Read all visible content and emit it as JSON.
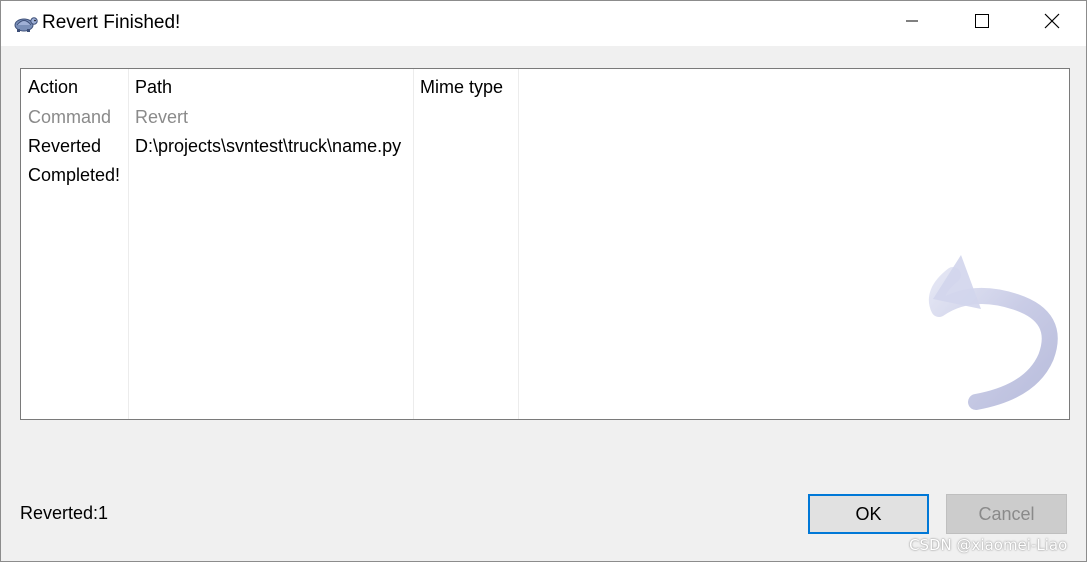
{
  "window": {
    "title": "Revert Finished!"
  },
  "list": {
    "columns": [
      "Action",
      "Path",
      "Mime type"
    ],
    "rows": [
      {
        "action": "Command",
        "path": "Revert",
        "mime": "",
        "style": "grey"
      },
      {
        "action": "Reverted",
        "path": "D:\\projects\\svntest\\truck\\name.py",
        "mime": "",
        "style": "normal"
      },
      {
        "action": "Completed!",
        "path": "",
        "mime": "",
        "style": "normal"
      }
    ]
  },
  "status": {
    "text": "Reverted:1"
  },
  "buttons": {
    "ok_label": "OK",
    "cancel_label": "Cancel"
  },
  "watermark": {
    "credit": "CSDN @xiaomei-Liao"
  },
  "icons": {
    "app": "tortoise-icon",
    "minimize": "minimize-icon",
    "maximize": "maximize-icon",
    "close": "close-icon",
    "watermark": "revert-arrow-icon"
  },
  "colors": {
    "accent": "#0078d7",
    "grey_text": "#8a8a8a",
    "arrow": "#c8cbe6"
  }
}
